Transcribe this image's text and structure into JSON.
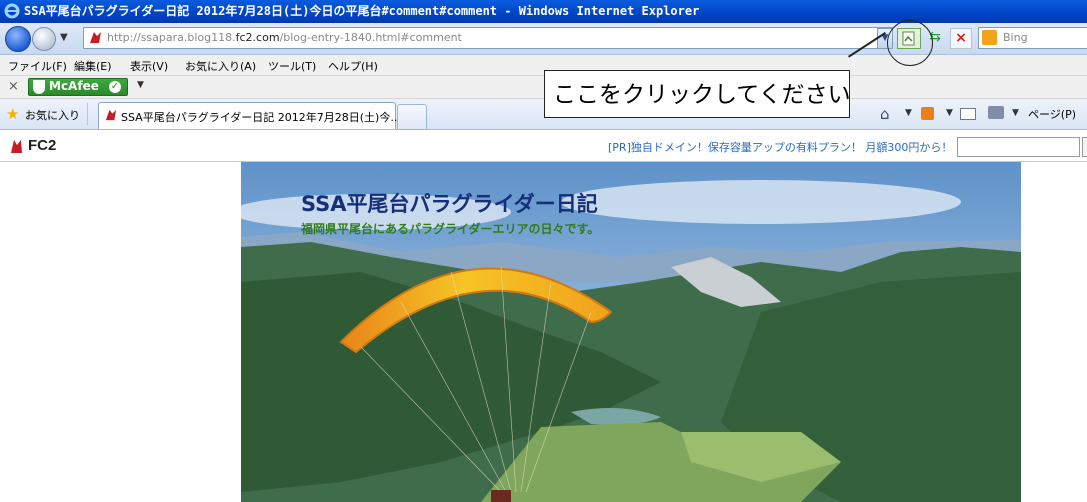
{
  "window": {
    "title": "SSA平尾台パラグライダー日記 2012年7月28日(土)今日の平尾台#comment#comment - Windows Internet Explorer"
  },
  "address_bar": {
    "url_prefix": "http://ssapara.blog118.",
    "url_host": "fc2.com",
    "url_suffix": "/blog-entry-1840.html#comment",
    "search_placeholder": "Bing"
  },
  "menu": {
    "items": [
      "ファイル(F)",
      "編集(E)",
      "表示(V)",
      "お気に入り(A)",
      "ツール(T)",
      "ヘルプ(H)"
    ]
  },
  "mcafee": {
    "label": "McAfee"
  },
  "callout": {
    "text": "ここをクリックしてください"
  },
  "tabs": {
    "favorites_label": "お気に入り",
    "active_tab": "SSA平尾台パラグライダー日記 2012年7月28日(土)今...",
    "page_menu": "ページ(P)"
  },
  "fc2": {
    "logo": "FC2",
    "ad_text": "[PR]独自ドメイン！保存容量アップの有料プラン！ 月額300円から！"
  },
  "blog": {
    "title": "SSA平尾台パラグライダー日記",
    "subtitle": "福岡県平尾台にあるパラグライダーエリアの日々です。"
  },
  "colors": {
    "titlebar": "#0244c4",
    "blog_title": "#152f7a",
    "blog_subtitle": "#2e7d1a",
    "fc2_ad": "#2a6bc2"
  }
}
